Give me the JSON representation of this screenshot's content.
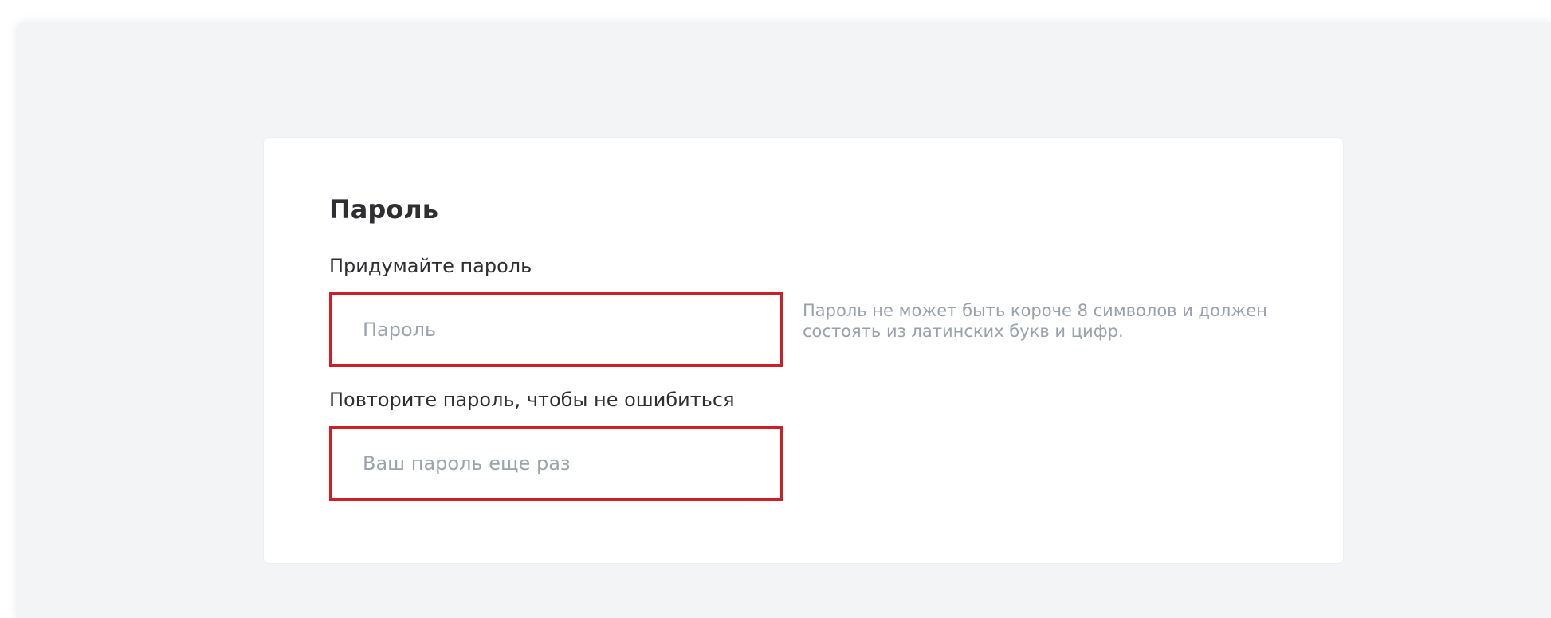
{
  "form": {
    "title": "Пароль",
    "password_label": "Придумайте пароль",
    "password_placeholder": "Пароль",
    "password_hint": "Пароль не может быть короче 8 символов и должен состоять из латинских букв и цифр.",
    "confirm_label": "Повторите пароль, чтобы не ошибиться",
    "confirm_placeholder": "Ваш пароль еще раз"
  },
  "colors": {
    "background": "#f3f4f6",
    "card": "#ffffff",
    "error_border": "#cc1f27",
    "text": "#2f2f33",
    "placeholder": "#9ba3ad",
    "hint": "#9aa1ab"
  }
}
